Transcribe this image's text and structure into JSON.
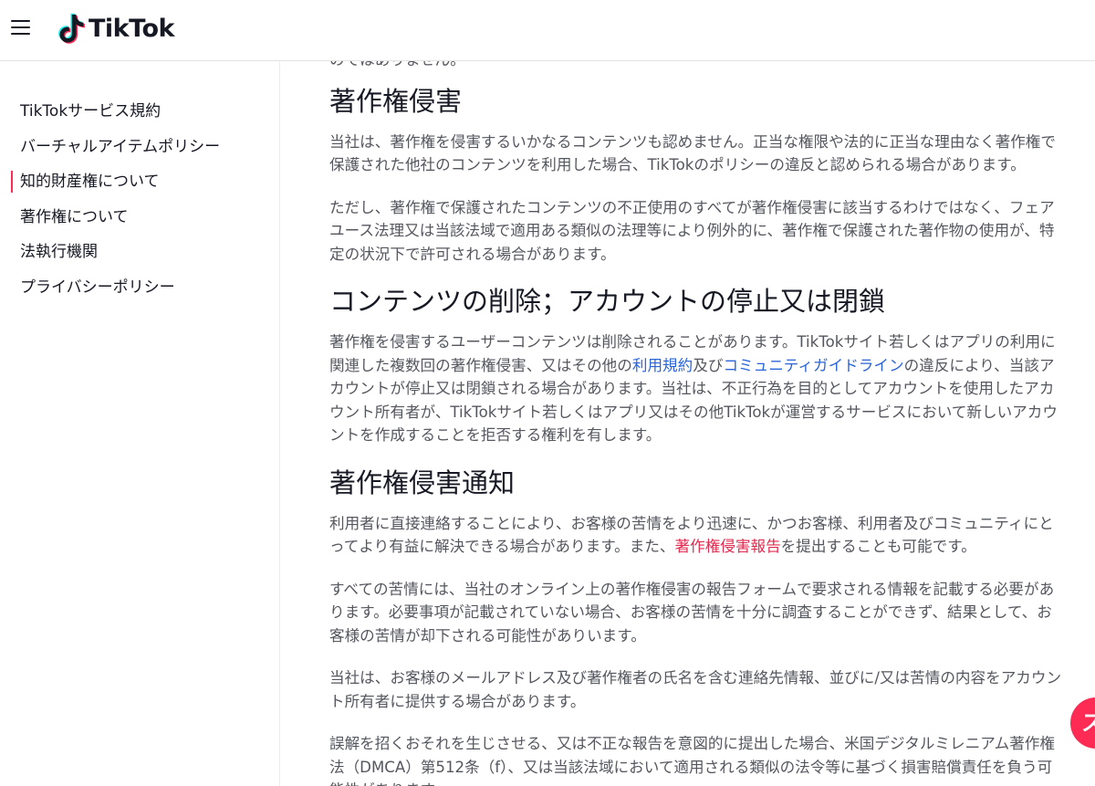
{
  "header": {
    "brand": "TikTok"
  },
  "sidebar": {
    "items": [
      {
        "label": "TikTokサービス規約",
        "active": false
      },
      {
        "label": "バーチャルアイテムポリシー",
        "active": false
      },
      {
        "label": "知的財産権について",
        "active": true
      },
      {
        "label": "著作権について",
        "active": false
      },
      {
        "label": "法執行機関",
        "active": false
      },
      {
        "label": "プライバシーポリシー",
        "active": false
      }
    ]
  },
  "content": {
    "intro_tail": "のではありません。",
    "sec1": {
      "heading": "著作権侵害",
      "p1": "当社は、著作権を侵害するいかなるコンテンツも認めません。正当な権限や法的に正当な理由なく著作権で保護された他社のコンテンツを利用した場合、TikTokのポリシーの違反と認められる場合があります。",
      "p2": "ただし、著作権で保護されたコンテンツの不正使用のすべてが著作権侵害に該当するわけではなく、フェアユース法理又は当該法域で適用ある類似の法理等により例外的に、著作権で保護された著作物の使用が、特定の状況下で許可される場合があります。"
    },
    "sec2": {
      "heading": "コンテンツの削除；アカウントの停止又は閉鎖",
      "p1_a": "著作権を侵害するユーザーコンテンツは削除されることがあります。TikTokサイト若しくはアプリの利用に関連した複数回の著作権侵害、又はその他の",
      "p1_link1": "利用規約",
      "p1_b": "及び",
      "p1_link2": "コミュニティガイドライン",
      "p1_c": "の違反により、当該アカウントが停止又は閉鎖される場合があります。当社は、不正行為を目的としてアカウントを使用したアカウント所有者が、TikTokサイト若しくはアプリ又はその他TikTokが運営するサービスにおいて新しいアカウントを作成することを拒否する権利を有します。"
    },
    "sec3": {
      "heading": "著作権侵害通知",
      "p1_a": "利用者に直接連絡することにより、お客様の苦情をより迅速に、かつお客様、利用者及びコミュニティにとってより有益に解決できる場合があります。また、",
      "p1_link": "著作権侵害報告",
      "p1_b": "を提出することも可能です。",
      "p2": "すべての苦情には、当社のオンライン上の著作権侵害の報告フォームで要求される情報を記載する必要があります。必要事項が記載されていない場合、お客様の苦情を十分に調査することができず、結果として、お客様の苦情が却下される可能性がありいます。",
      "p3": "当社は、お客様のメールアドレス及び著作権者の氏名を含む連絡先情報、並びに/又は苦情の内容をアカウント所有者に提供する場合があります。",
      "p4": "誤解を招くおそれを生じさせる、又は不正な報告を意図的に提出した場合、米国デジタルミレニアム著作権法（DMCA）第512条（f）、又は当該法域において適用される類似の法令等に基づく損害賠償責任を負う可能性があります。"
    }
  },
  "fab": {
    "label": "ス"
  },
  "colors": {
    "accent": "#fe2c55",
    "link": "#2b65d9",
    "text": "#161823",
    "body_text": "#55575f"
  }
}
